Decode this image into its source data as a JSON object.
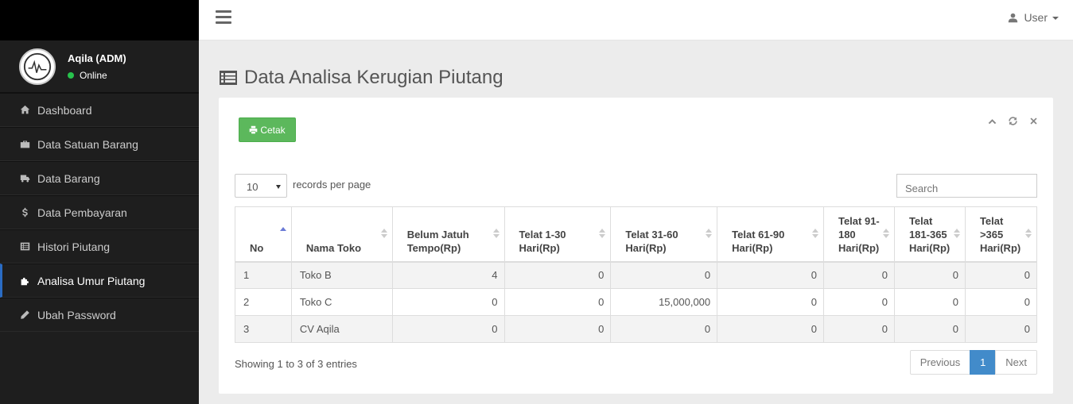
{
  "sidebar": {
    "user_name": "Aqila (ADM)",
    "status": "Online",
    "items": [
      {
        "label": "Dashboard",
        "icon": "home-icon"
      },
      {
        "label": "Data Satuan Barang",
        "icon": "briefcase-icon"
      },
      {
        "label": "Data Barang",
        "icon": "truck-icon"
      },
      {
        "label": "Data Pembayaran",
        "icon": "dollar-icon"
      },
      {
        "label": "Histori Piutang",
        "icon": "list-icon"
      },
      {
        "label": "Analisa Umur Piutang",
        "icon": "puzzle-icon",
        "active": true
      },
      {
        "label": "Ubah Password",
        "icon": "pencil-icon"
      }
    ]
  },
  "topbar": {
    "user_label": "User"
  },
  "page": {
    "title": "Data Analisa Kerugian Piutang"
  },
  "panel": {
    "print_label": "Cetak",
    "length_value": "10",
    "length_label": "records per page",
    "search_placeholder": "Search"
  },
  "table": {
    "headers": [
      "No",
      "Nama Toko",
      "Belum Jatuh Tempo(Rp)",
      "Telat 1-30 Hari(Rp)",
      "Telat 31-60 Hari(Rp)",
      "Telat 61-90 Hari(Rp)",
      "Telat 91-180 Hari(Rp)",
      "Telat 181-365 Hari(Rp)",
      "Telat >365 Hari(Rp)"
    ],
    "rows": [
      [
        "1",
        "Toko B",
        "4",
        "0",
        "0",
        "0",
        "0",
        "0",
        "0"
      ],
      [
        "2",
        "Toko C",
        "0",
        "0",
        "15,000,000",
        "0",
        "0",
        "0",
        "0"
      ],
      [
        "3",
        "CV Aqila",
        "0",
        "0",
        "0",
        "0",
        "0",
        "0",
        "0"
      ]
    ]
  },
  "footer": {
    "info": "Showing 1 to 3 of 3 entries",
    "prev": "Previous",
    "current_page": "1",
    "next": "Next"
  },
  "colors": {
    "sidebar_bg": "#1e1e1e",
    "brand_bg": "#000000",
    "accent": "#428bca",
    "print_button": "#5cb85c",
    "online": "#27c24c"
  }
}
